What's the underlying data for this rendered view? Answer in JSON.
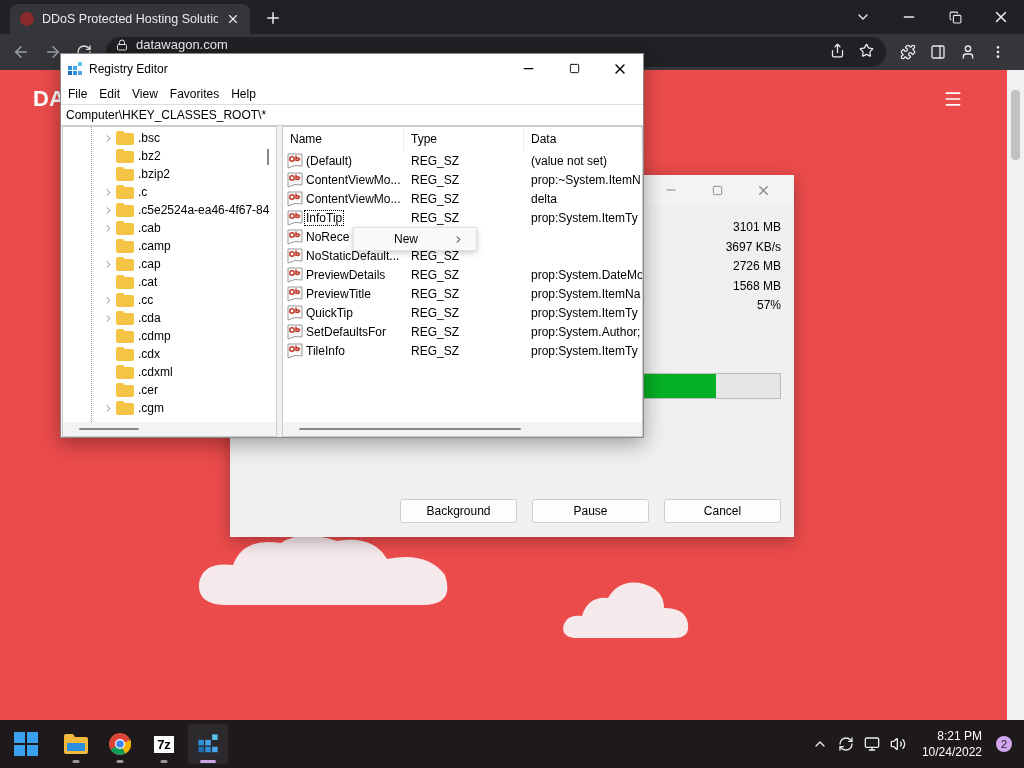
{
  "browser": {
    "tabs": [
      {
        "title": "DDoS Protected Hosting Solutio",
        "selected": true
      }
    ],
    "address": "datawagon.com"
  },
  "page": {
    "logo": "DA"
  },
  "progress_dialog": {
    "values": [
      "3101 MB",
      "3697 KB/s",
      "2726 MB",
      "1568 MB",
      "57%"
    ],
    "level": 0.88,
    "buttons": [
      "Background",
      "Pause",
      "Cancel"
    ]
  },
  "registry_editor": {
    "title": "Registry Editor",
    "menu": [
      "File",
      "Edit",
      "View",
      "Favorites",
      "Help"
    ],
    "address": "Computer\\HKEY_CLASSES_ROOT\\*",
    "tree": [
      {
        "label": ".bsc",
        "expandable": true
      },
      {
        "label": ".bz2",
        "expandable": false
      },
      {
        "label": ".bzip2",
        "expandable": false
      },
      {
        "label": ".c",
        "expandable": true
      },
      {
        "label": ".c5e2524a-ea46-4f67-84",
        "expandable": true
      },
      {
        "label": ".cab",
        "expandable": true
      },
      {
        "label": ".camp",
        "expandable": false
      },
      {
        "label": ".cap",
        "expandable": true
      },
      {
        "label": ".cat",
        "expandable": false
      },
      {
        "label": ".cc",
        "expandable": true
      },
      {
        "label": ".cda",
        "expandable": true
      },
      {
        "label": ".cdmp",
        "expandable": false
      },
      {
        "label": ".cdx",
        "expandable": false
      },
      {
        "label": ".cdxml",
        "expandable": false
      },
      {
        "label": ".cer",
        "expandable": false
      },
      {
        "label": ".cgm",
        "expandable": true
      }
    ],
    "columns": [
      "Name",
      "Type",
      "Data"
    ],
    "rows": [
      {
        "name": "(Default)",
        "type": "REG_SZ",
        "data": "(value not set)",
        "selected": false
      },
      {
        "name": "ContentViewMo...",
        "type": "REG_SZ",
        "data": "prop:~System.ItemN",
        "selected": false
      },
      {
        "name": "ContentViewMo...",
        "type": "REG_SZ",
        "data": "delta",
        "selected": false
      },
      {
        "name": "InfoTip",
        "type": "REG_SZ",
        "data": "prop:System.ItemTy",
        "selected": true
      },
      {
        "name": "NoRece",
        "selected": false
      },
      {
        "name": "NoStaticDefault...",
        "type": "REG_SZ",
        "selected": false
      },
      {
        "name": "PreviewDetails",
        "type": "REG_SZ",
        "data": "prop:System.DateMo",
        "selected": false
      },
      {
        "name": "PreviewTitle",
        "type": "REG_SZ",
        "data": "prop:System.ItemNa",
        "selected": false
      },
      {
        "name": "QuickTip",
        "type": "REG_SZ",
        "data": "prop:System.ItemTy",
        "selected": false
      },
      {
        "name": "SetDefaultsFor",
        "type": "REG_SZ",
        "data": "prop:System.Author;",
        "selected": false
      },
      {
        "name": "TileInfo",
        "type": "REG_SZ",
        "data": "prop:System.ItemTy",
        "selected": false
      }
    ]
  },
  "context_menu": {
    "items": [
      {
        "label": "New",
        "submenu": true
      }
    ]
  },
  "taskbar": {
    "apps": [
      {
        "kind": "explorer",
        "selected": false
      },
      {
        "kind": "chrome",
        "selected": false
      },
      {
        "kind": "archiver",
        "label": "7z",
        "selected": false
      },
      {
        "kind": "registry",
        "selected": true
      }
    ],
    "time": "8:21 PM",
    "date": "10/24/2022",
    "notifications": "2"
  }
}
